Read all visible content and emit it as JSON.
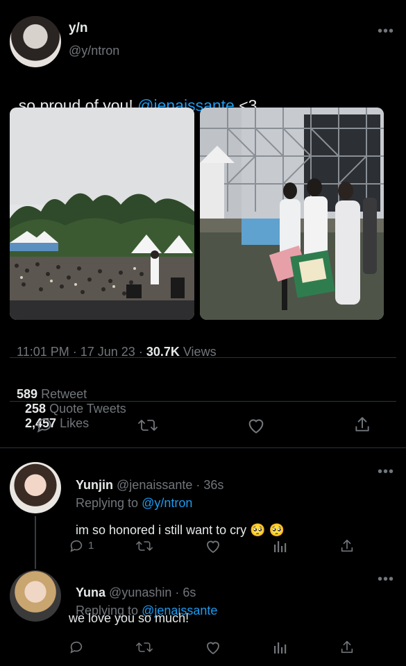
{
  "tweet": {
    "author_name": "y/n",
    "author_handle": "@y/ntron",
    "text_prefix": "so proud of you! ",
    "text_mention": "@jenaissante",
    "text_suffix": " <3",
    "time": "11:01 PM",
    "date": "17 Jun 23",
    "views_count": "30.7K",
    "views_label": "Views",
    "retweets_count": "589",
    "retweets_label": "Retweet",
    "quotes_count": "258",
    "quotes_label": "Quote Tweets",
    "likes_count": "2,457",
    "likes_label": "Likes",
    "photo1": "outdoor concert crowd photo",
    "photo2": "group hug backstage photo"
  },
  "replies": [
    {
      "name": "Yunjin",
      "handle": "@jenaissante",
      "time": "36s",
      "replying_label": "Replying to",
      "replying_to": "@y/ntron",
      "text": "im so honored i still want to cry",
      "emoji": "🥺 🥺",
      "reply_count": "1"
    },
    {
      "name": "Yuna",
      "handle": "@yunashin",
      "time": "6s",
      "replying_label": "Replying to",
      "replying_to": "@jenaissante",
      "text": "we love you so much!"
    }
  ],
  "colors": {
    "background": "#000000",
    "text": "#e7e9ea",
    "muted": "#71767b",
    "accent": "#1d9bf0",
    "divider": "#2f3336"
  },
  "icons": {
    "reply": "reply-icon",
    "retweet": "retweet-icon",
    "like": "heart-icon",
    "share": "share-icon",
    "views": "analytics-icon",
    "more": "more-icon"
  }
}
